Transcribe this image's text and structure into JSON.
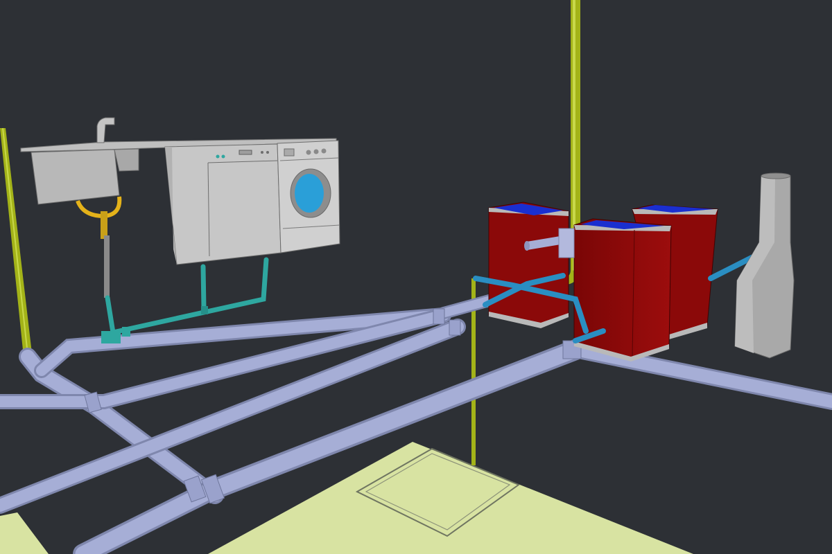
{
  "scene": {
    "background": "#2d3035",
    "colors": {
      "drain_pipe": "#a6aed6",
      "drain_pipe_shade": "#7f87ad",
      "vent_pipe": "#a3b318",
      "water_supply": "#2ea7a0",
      "cold_supply": "#2a8ec2",
      "tank_body": "#8b0909",
      "tank_top": "#1a2fd0",
      "appliance_grey": "#c7c7c7",
      "washer_door": "#2a9fd8",
      "trap_yellow": "#e4b21a",
      "floor": "#d8e3a2",
      "separator_grey": "#a9a9a9"
    },
    "objects": [
      {
        "name": "kitchen-sink"
      },
      {
        "name": "dishwasher"
      },
      {
        "name": "washing-machine"
      },
      {
        "name": "grease-tank"
      },
      {
        "name": "grease-tank"
      },
      {
        "name": "grease-tank"
      },
      {
        "name": "conical-separator"
      },
      {
        "name": "floor-drain"
      }
    ]
  }
}
